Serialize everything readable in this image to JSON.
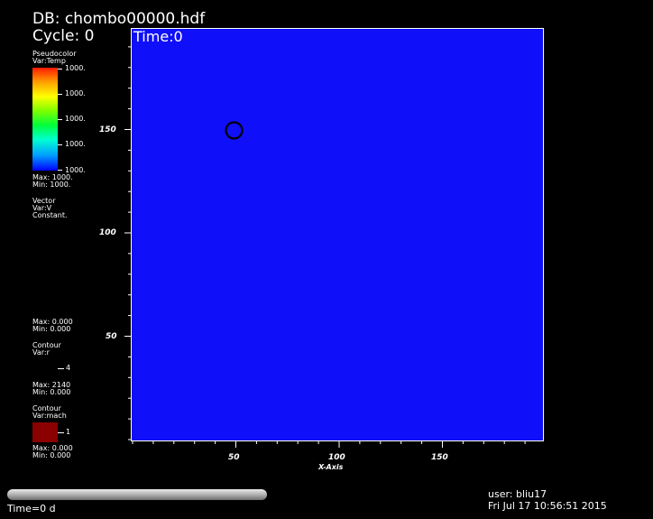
{
  "header": {
    "db": "DB: chombo00000.hdf",
    "cycle": "Cycle: 0",
    "time": "Time:0"
  },
  "legend": {
    "pseudocolor": {
      "title": "Pseudocolor",
      "var": "Var:Temp",
      "ticks": [
        "1000.",
        "1000.",
        "1000.",
        "1000.",
        "1000."
      ],
      "max": "Max: 1000.",
      "min": "Min: 1000."
    },
    "vector": {
      "title": "Vector",
      "var": "Var:V",
      "note": "Constant.",
      "max": "Max: 0.000",
      "min": "Min: 0.000"
    },
    "contour_r": {
      "title": "Contour",
      "var": "Var:r",
      "level": "4",
      "max": "Max: 2140",
      "min": "Min: 0.000"
    },
    "contour_mach": {
      "title": "Contour",
      "var": "Var:mach",
      "level": "1",
      "max": "Max: 0.000",
      "min": "Min: 0.000",
      "color": "#8b0000"
    }
  },
  "plot": {
    "background": "#0f0ffa",
    "x_axis_label": "X-Axis",
    "x_ticks": [
      "50",
      "100",
      "150"
    ],
    "y_ticks": [
      "150",
      "100",
      "50"
    ]
  },
  "footer": {
    "time_slider_label": "Time=0 d",
    "user": "user: bliu17",
    "date": "Fri Jul 17 10:56:51 2015"
  }
}
